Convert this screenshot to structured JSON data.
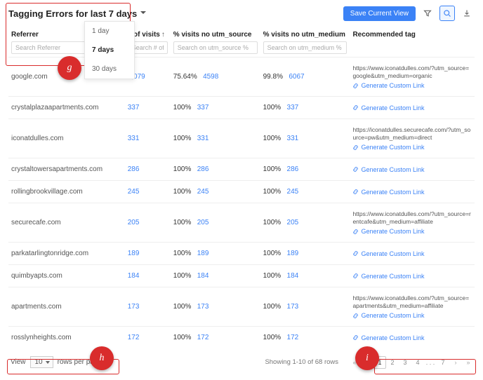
{
  "header": {
    "title": "Tagging Errors for last 7 days",
    "dropdown": {
      "options": [
        "1 day",
        "7 days",
        "30 days"
      ],
      "selected": "7 days"
    },
    "save_btn": "Save Current View"
  },
  "columns": {
    "referrer": {
      "label": "Referrer",
      "placeholder": "Search Referrer"
    },
    "visits": {
      "label": "# of visits",
      "placeholder": "Search # of v"
    },
    "no_source": {
      "label": "% visits no utm_source",
      "placeholder": "Search on utm_source %"
    },
    "no_medium": {
      "label": "% visits no utm_medium",
      "placeholder": "Search on utm_medium %"
    },
    "recommended": {
      "label": "Recommended tag"
    }
  },
  "rows": [
    {
      "referrer": "google.com",
      "visits": "6,079",
      "src_pct": "75.64%",
      "src_n": "4598",
      "med_pct": "99.8%",
      "med_n": "6067",
      "rec": "https://www.iconatdulles.com/?utm_source=google&utm_medium=organic"
    },
    {
      "referrer": "crystalplazaapartments.com",
      "visits": "337",
      "src_pct": "100%",
      "src_n": "337",
      "med_pct": "100%",
      "med_n": "337",
      "rec": ""
    },
    {
      "referrer": "iconatdulles.com",
      "visits": "331",
      "src_pct": "100%",
      "src_n": "331",
      "med_pct": "100%",
      "med_n": "331",
      "rec": "https://iconatdulles.securecafe.com/?utm_source=pw&utm_medium=direct"
    },
    {
      "referrer": "crystaltowersapartments.com",
      "visits": "286",
      "src_pct": "100%",
      "src_n": "286",
      "med_pct": "100%",
      "med_n": "286",
      "rec": ""
    },
    {
      "referrer": "rollingbrookvillage.com",
      "visits": "245",
      "src_pct": "100%",
      "src_n": "245",
      "med_pct": "100%",
      "med_n": "245",
      "rec": ""
    },
    {
      "referrer": "securecafe.com",
      "visits": "205",
      "src_pct": "100%",
      "src_n": "205",
      "med_pct": "100%",
      "med_n": "205",
      "rec": "https://www.iconatdulles.com/?utm_source=rentcafe&utm_medium=affiliate"
    },
    {
      "referrer": "parkatarlingtonridge.com",
      "visits": "189",
      "src_pct": "100%",
      "src_n": "189",
      "med_pct": "100%",
      "med_n": "189",
      "rec": ""
    },
    {
      "referrer": "quimbyapts.com",
      "visits": "184",
      "src_pct": "100%",
      "src_n": "184",
      "med_pct": "100%",
      "med_n": "184",
      "rec": ""
    },
    {
      "referrer": "apartments.com",
      "visits": "173",
      "src_pct": "100%",
      "src_n": "173",
      "med_pct": "100%",
      "med_n": "173",
      "rec": "https://www.iconatdulles.com/?utm_source=apartments&utm_medium=affiliate"
    },
    {
      "referrer": "rosslynheights.com",
      "visits": "172",
      "src_pct": "100%",
      "src_n": "172",
      "med_pct": "100%",
      "med_n": "172",
      "rec": ""
    }
  ],
  "gen_link_label": "Generate Custom Link",
  "footer": {
    "view_label": "View",
    "rows_value": "10",
    "rows_suffix": "rows per page",
    "info": "Showing 1-10 of 68 rows",
    "pages": [
      "1",
      "2",
      "3",
      "4",
      ". . .",
      "7"
    ],
    "current_page": "1"
  },
  "annotations": {
    "g": "g",
    "h": "h",
    "i": "i"
  }
}
